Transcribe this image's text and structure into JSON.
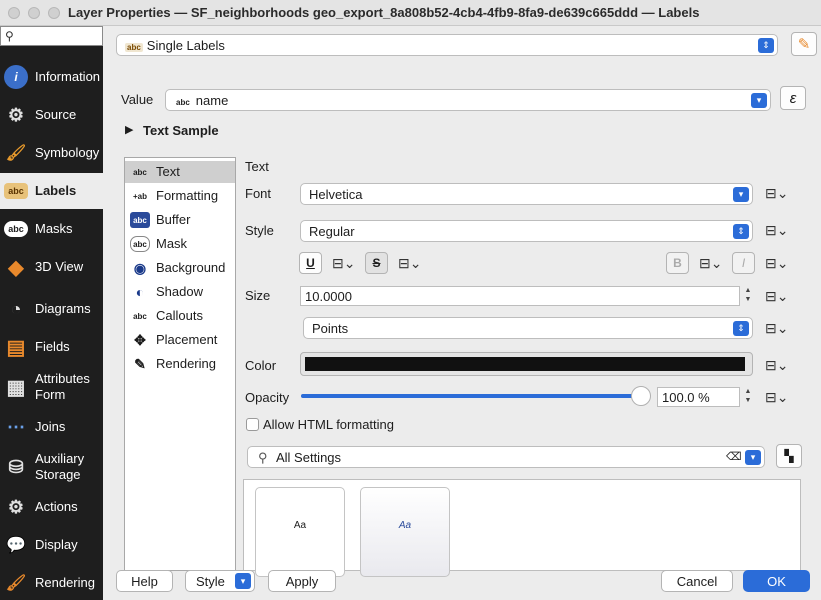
{
  "window": {
    "title": "Layer Properties — SF_neighborhoods geo_export_8a808b52-4cb4-4fb9-8fa9-de639c665ddd — Labels"
  },
  "sidebar": {
    "search_glyph": "⚲",
    "items": [
      {
        "label": "Information",
        "icon": "info-icon",
        "glyph": "i"
      },
      {
        "label": "Source",
        "icon": "source-icon",
        "glyph": "⚙"
      },
      {
        "label": "Symbology",
        "icon": "symbology-icon",
        "glyph": "🖌"
      },
      {
        "label": "Labels",
        "icon": "labels-icon",
        "glyph": "abc"
      },
      {
        "label": "Masks",
        "icon": "masks-icon",
        "glyph": "abc"
      },
      {
        "label": "3D View",
        "icon": "3d-view-icon",
        "glyph": "◆"
      },
      {
        "label": "Diagrams",
        "icon": "diagrams-icon",
        "glyph": "◔"
      },
      {
        "label": "Fields",
        "icon": "fields-icon",
        "glyph": "▤"
      },
      {
        "label": "Attributes Form",
        "icon": "attributes-form-icon",
        "glyph": "▦"
      },
      {
        "label": "Joins",
        "icon": "joins-icon",
        "glyph": "⋯"
      },
      {
        "label": "Auxiliary Storage",
        "icon": "auxiliary-storage-icon",
        "glyph": "⛁"
      },
      {
        "label": "Actions",
        "icon": "actions-icon",
        "glyph": "⚙"
      },
      {
        "label": "Display",
        "icon": "display-icon",
        "glyph": "💬"
      },
      {
        "label": "Rendering",
        "icon": "rendering-icon",
        "glyph": "🖌"
      }
    ]
  },
  "mode": {
    "value": "Single Labels",
    "icon_text": "abc"
  },
  "value_row": {
    "label": "Value",
    "value": "name",
    "icon_text": "abc",
    "expr_glyph": "ε"
  },
  "text_sample": {
    "label": "Text Sample",
    "glyph": "▶"
  },
  "tabs": [
    {
      "label": "Text",
      "glyph": "abc"
    },
    {
      "label": "Formatting",
      "glyph": "+ab"
    },
    {
      "label": "Buffer",
      "glyph": "abc"
    },
    {
      "label": "Mask",
      "glyph": "abc"
    },
    {
      "label": "Background",
      "glyph": "◉"
    },
    {
      "label": "Shadow",
      "glyph": "◐"
    },
    {
      "label": "Callouts",
      "glyph": "abc"
    },
    {
      "label": "Placement",
      "glyph": "✥"
    },
    {
      "label": "Rendering",
      "glyph": "✎"
    }
  ],
  "text_panel": {
    "heading": "Text",
    "font_label": "Font",
    "font_value": "Helvetica",
    "style_label": "Style",
    "style_value": "Regular",
    "underline_glyph": "U",
    "strike_glyph": "S",
    "bold_glyph": "B",
    "italic_glyph": "I",
    "size_label": "Size",
    "size_value": "10.0000",
    "unit_value": "Points",
    "color_label": "Color",
    "color_value": "#111111",
    "opacity_label": "Opacity",
    "opacity_value": "100.0 %",
    "opacity_fraction": 1.0,
    "html_label": "Allow HTML formatting",
    "dd_glyph": "⊟⌄"
  },
  "settings": {
    "search_glyph": "⚲",
    "value": "All Settings",
    "clear_glyph": "⌫"
  },
  "preview": {
    "cards": [
      "Aa",
      "Aa"
    ]
  },
  "buttons": {
    "help": "Help",
    "style": "Style",
    "apply": "Apply",
    "cancel": "Cancel",
    "ok": "OK"
  },
  "colors": {
    "accent": "#2b6cd8",
    "sidebar_bg": "#1e1e1e"
  }
}
